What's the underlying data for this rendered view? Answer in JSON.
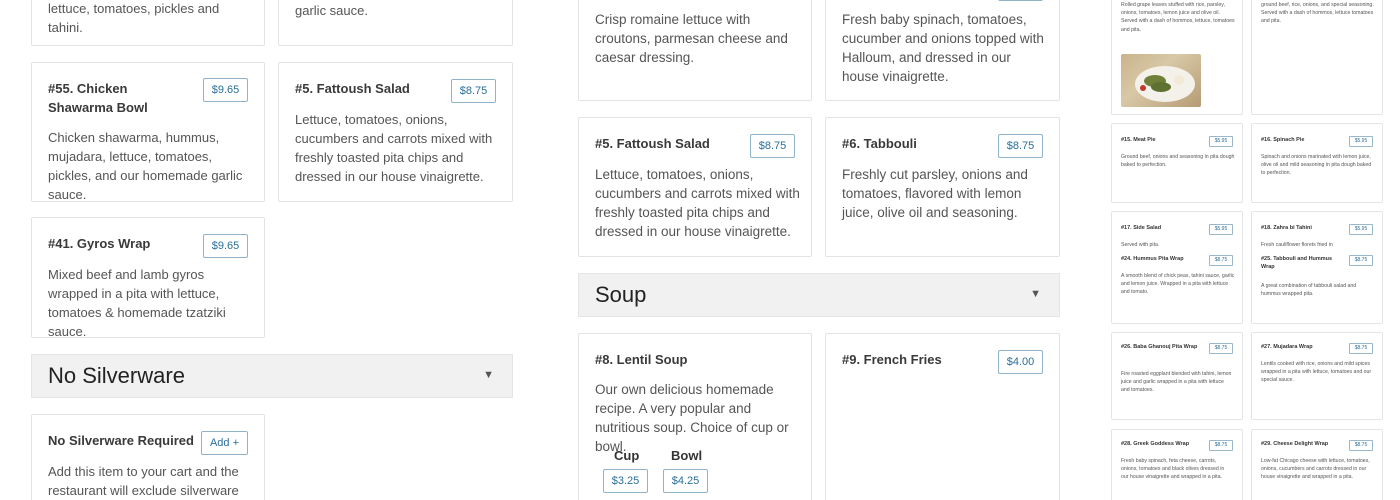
{
  "col1": {
    "top_card_desc": "lettuce, tomatoes, pickles and tahini.",
    "item55": {
      "title": "#55. Chicken Shawarma Bowl",
      "price": "$9.65",
      "desc": "Chicken shawarma, hummus, mujadara, lettuce, tomatoes, pickles, and our homemade garlic sauce."
    },
    "item41": {
      "title": "#41. Gyros Wrap",
      "price": "$9.65",
      "desc": "Mixed beef and lamb gyros wrapped in a pita with lettuce, tomatoes & homemade tzatziki sauce."
    },
    "section": {
      "name": "No Silverware",
      "arrow": "▼"
    },
    "nosilver": {
      "title": "No Silverware Required",
      "button": "Add +",
      "desc": "Add this item to your cart and the restaurant will exclude silverware"
    }
  },
  "col2": {
    "top_card_desc": "pickles and our homemade garlic sauce.",
    "item5": {
      "title": "#5. Fattoush Salad",
      "price": "$8.75",
      "desc": "Lettuce, tomatoes, onions, cucumbers and carrots mixed with freshly toasted pita chips and dressed in our house vinaigrette."
    }
  },
  "col3": {
    "caesar_desc": "Crisp romaine lettuce with croutons, parmesan cheese and caesar dressing.",
    "item5": {
      "title": "#5. Fattoush Salad",
      "price": "$8.75",
      "desc": "Lettuce, tomatoes, onions, cucumbers and carrots mixed with freshly toasted pita chips and dressed in our house vinaigrette."
    },
    "section": {
      "name": "Soup",
      "arrow": "▼"
    },
    "item8": {
      "title": "#8. Lentil Soup",
      "desc": "Our own delicious homemade recipe. A very popular and nutritious soup. Choice of cup or bowl.",
      "cup_label": "Cup",
      "cup_price": "$3.25",
      "bowl_label": "Bowl",
      "bowl_price": "$4.25"
    }
  },
  "col4": {
    "spinach_salad_desc": "Fresh baby spinach, tomatoes, cucumber and onions topped with Halloum, and dressed in our house vinaigrette.",
    "item6": {
      "title": "#6. Tabbouli",
      "price": "$8.75",
      "desc": "Freshly cut parsley, onions and tomatoes, flavored with lemon juice, olive oil and seasoning."
    },
    "item9": {
      "title": "#9. French Fries",
      "price": "$4.00"
    }
  },
  "mini": {
    "grape_desc": "Rolled grape leaves stuffed with rice, parsley, onions, tomatoes, lemon juice and olive oil. Served with a dash of hommos, lettuce, tomatoes and pita.",
    "beef_desc": "ground beef, rice, onions, and special seasoning. Served with a dash of hommos, lettuce tomatoes and pita.",
    "i15": {
      "t": "#15. Meat Pie",
      "p": "$5.95",
      "d": "Ground beef, onions and seasoning in pita dough baked to perfection."
    },
    "i16": {
      "t": "#16. Spinach Pie",
      "p": "$5.95",
      "d": "Spinach and onions marinated with lemon juice, olive oil and mild seasoning in pita dough baked to perfection."
    },
    "i17": {
      "t": "#17. Side Salad",
      "p": "$5.95",
      "d": "Served with pita."
    },
    "i24": {
      "t": "#24. Hummus Pita Wrap",
      "p": "$8.75",
      "d": "A smooth blend of chick peas, tahini sauce, garlic and lemon juice. Wrapped in a pita with lettuce and tomato."
    },
    "i18": {
      "t": "#18. Zahra bi Tahini",
      "p": "$5.95",
      "d": "Fresh cauliflower florets fried in"
    },
    "i25": {
      "t": "#25. Tabbouli and Hummus Wrap",
      "p": "$8.75",
      "d": "A great combination of tabbouli salad and hummus wrapped pita."
    },
    "i26": {
      "t": "#26. Baba Ghanouj Pita Wrap",
      "p": "$8.75",
      "d": "Fire roasted eggplant blended with tahini, lemon juice and garlic wrapped in a pita with lettuce and tomatoes."
    },
    "i27": {
      "t": "#27. Mujadara Wrap",
      "p": "$8.75",
      "d": "Lentils cooked with rice, onions and mild spices wrapped in a pita with lettuce, tomatoes and our special sauce."
    },
    "i28": {
      "t": "#28. Greek Goddess Wrap",
      "p": "$8.75",
      "d": "Fresh baby spinach, feta cheese, carrots, onions, tomatoes and black olives dressed in our house vinaigrette and wrapped in a pita."
    },
    "i29": {
      "t": "#29. Cheese Delight Wrap",
      "p": "$8.75",
      "d": "Low-fat Chicago cheese with lettuce, tomatoes, onions, cucumbers and carrots dressed in our house vinaigrette and wrapped in a pita."
    }
  }
}
